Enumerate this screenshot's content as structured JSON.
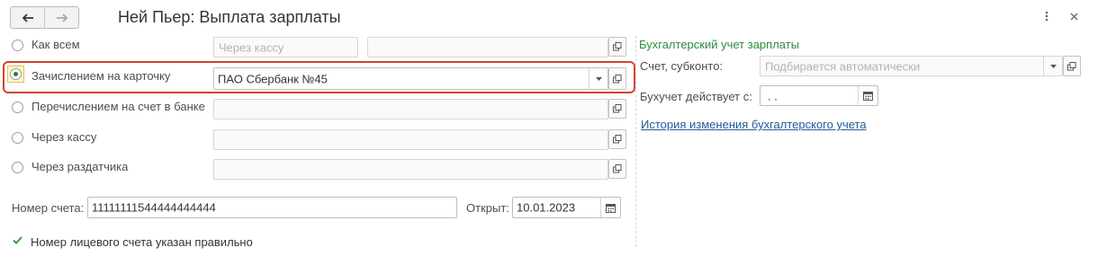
{
  "window": {
    "title": "Ней Пьер: Выплата зарплаты",
    "back_icon": "arrow-left-icon",
    "forward_icon": "arrow-right-icon",
    "more_icon": "vertical-dots-icon",
    "close_icon": "close-icon"
  },
  "payment_options": [
    {
      "label": "Как всем",
      "selected": false
    },
    {
      "label": "Зачислением на карточку",
      "selected": true
    },
    {
      "label": "Перечислением на счет в банке",
      "selected": false
    },
    {
      "label": "Через кассу",
      "selected": false
    },
    {
      "label": "Через раздатчика",
      "selected": false
    }
  ],
  "fields": {
    "kak_vsem_method_placeholder": "Через кассу",
    "kak_vsem_detail": "",
    "card_bank": "ПАО Сбербанк №45",
    "bank_account": "",
    "cash_desk": "",
    "distributor": ""
  },
  "account": {
    "number_label": "Номер счета:",
    "number_value": "11111111544444444444",
    "opened_label": "Открыт:",
    "opened_value": "10.01.2023",
    "validation_text": "Номер лицевого счета указан правильно"
  },
  "accounting": {
    "section_title": "Бухгалтерский учет зарплаты",
    "subconto_label": "Счет, субконто:",
    "subconto_placeholder": "Подбирается автоматически",
    "effective_label": "Бухучет действует с:",
    "effective_value": " .  .",
    "history_link": "История изменения бухгалтерского учета"
  },
  "colors": {
    "accent_green": "#2e8b3d",
    "highlight_red": "#d34230",
    "link_blue": "#1f5c99"
  }
}
